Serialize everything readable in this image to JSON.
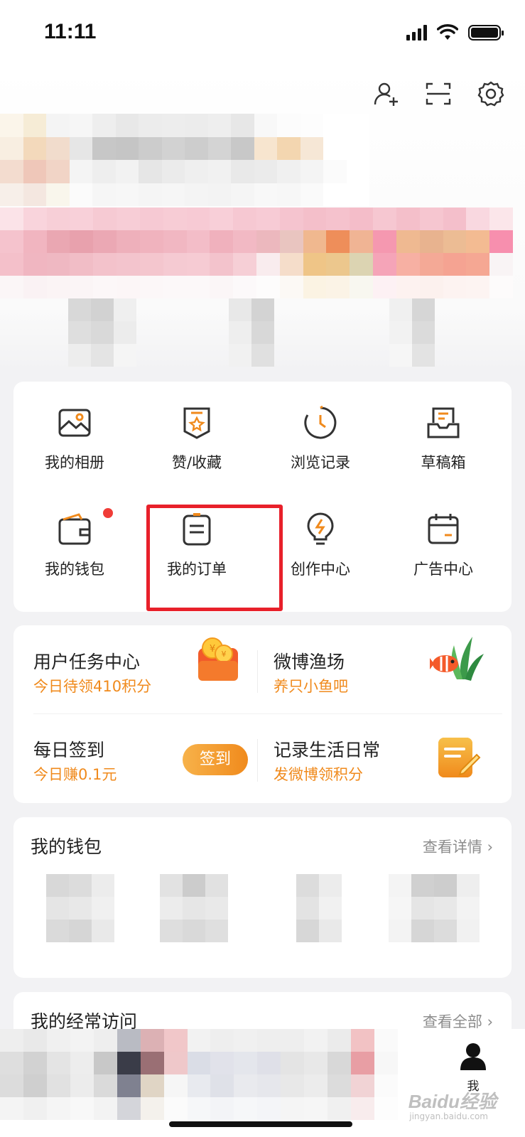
{
  "status_bar": {
    "time": "11:11"
  },
  "shortcuts": [
    {
      "label": "我的相册",
      "icon": "photo-album-icon"
    },
    {
      "label": "赞/收藏",
      "icon": "favorite-star-icon"
    },
    {
      "label": "浏览记录",
      "icon": "history-clock-icon"
    },
    {
      "label": "草稿箱",
      "icon": "draft-box-icon"
    },
    {
      "label": "我的钱包",
      "icon": "wallet-icon"
    },
    {
      "label": "我的订单",
      "icon": "order-clipboard-icon"
    },
    {
      "label": "创作中心",
      "icon": "lightbulb-icon"
    },
    {
      "label": "广告中心",
      "icon": "calendar-icon"
    }
  ],
  "tasks": {
    "user_task": {
      "title": "用户任务中心",
      "subtitle": "今日待领410积分"
    },
    "fishery": {
      "title": "微博渔场",
      "subtitle": "养只小鱼吧"
    },
    "checkin": {
      "title": "每日签到",
      "subtitle": "今日赚0.1元",
      "button": "签到"
    },
    "record": {
      "title": "记录生活日常",
      "subtitle": "发微博领积分"
    }
  },
  "wallet": {
    "title": "我的钱包",
    "link": "查看详情"
  },
  "frequent": {
    "title": "我的经常访问",
    "link": "查看全部"
  },
  "tab_bar": {
    "me_label": "我"
  },
  "watermark": {
    "text": "Baidu经验",
    "sub": "jingyan.baidu.com"
  },
  "colors": {
    "accent": "#f08a1c",
    "highlight": "#e8202a",
    "dot": "#f03c37"
  }
}
